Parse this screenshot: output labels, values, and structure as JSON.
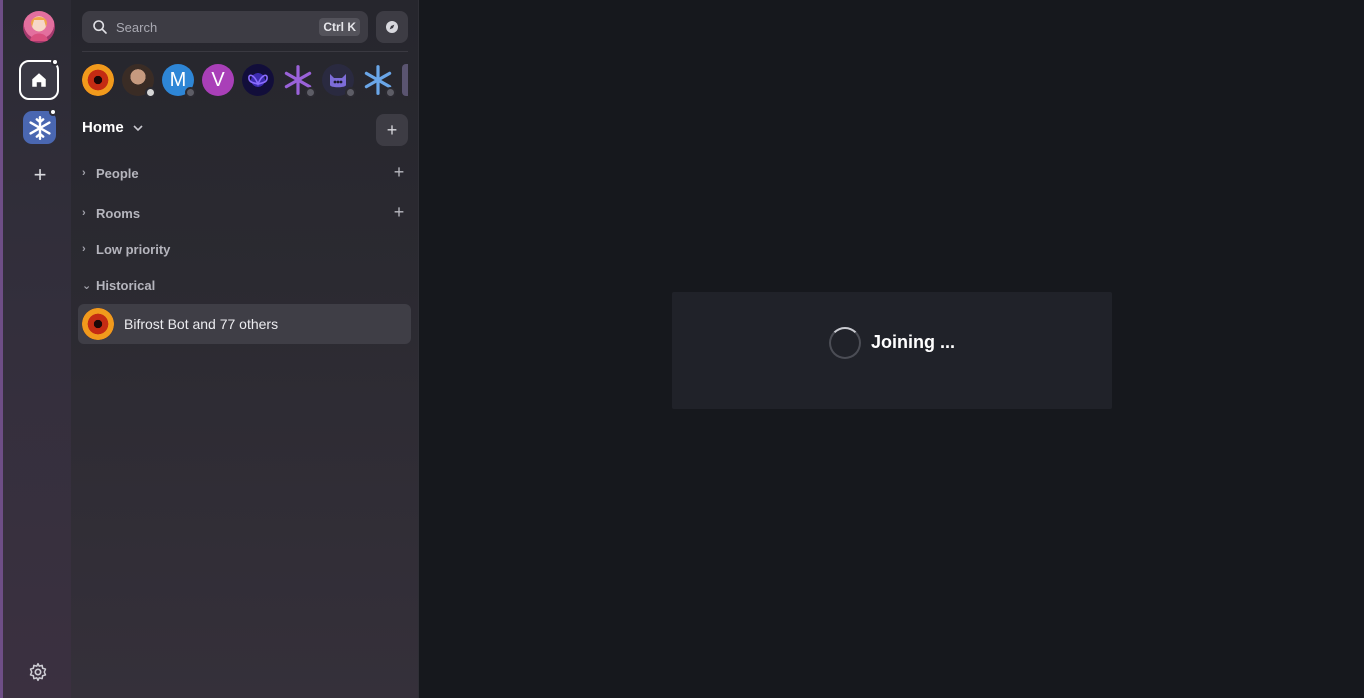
{
  "rail": {
    "items": [
      {
        "name": "home",
        "icon": "home-icon",
        "active": true,
        "unread": true
      },
      {
        "name": "space",
        "icon": "snowflake-icon",
        "unread": true
      }
    ],
    "add_icon": "plus-icon",
    "settings_icon": "gear-icon"
  },
  "sidebar": {
    "search": {
      "placeholder": "Search",
      "shortcut": "Ctrl K"
    },
    "explore_icon": "compass-icon",
    "recent_rooms": [
      {
        "kind": "image",
        "icon": "phoenix-avatar",
        "color": "#d33c16"
      },
      {
        "kind": "image",
        "icon": "person-avatar",
        "color": "#5b4a40"
      },
      {
        "kind": "letter",
        "letter": "M",
        "color": "#2e86d6"
      },
      {
        "kind": "letter",
        "letter": "V",
        "color": "#a93fb8"
      },
      {
        "kind": "image",
        "icon": "butterfly-avatar",
        "color": "#120e3a"
      },
      {
        "kind": "image",
        "icon": "snowflake-purple-avatar",
        "color": "#2b2a31"
      },
      {
        "kind": "image",
        "icon": "cat-avatar",
        "color": "#2a2a40"
      },
      {
        "kind": "image",
        "icon": "snowflake-blue-avatar",
        "color": "#2b2a31"
      }
    ],
    "home_label": "Home",
    "sections": [
      {
        "label": "People",
        "expanded": false,
        "has_add": true
      },
      {
        "label": "Rooms",
        "expanded": false,
        "has_add": true
      },
      {
        "label": "Low priority",
        "expanded": false,
        "has_add": false
      },
      {
        "label": "Historical",
        "expanded": true,
        "has_add": false
      }
    ],
    "historical_rooms": [
      {
        "name": "Bifrost Bot and 77 others",
        "selected": true
      }
    ]
  },
  "main": {
    "status": "Joining ..."
  },
  "colors": {
    "accent_border": "#6e4e86",
    "main_bg": "#16181d",
    "card_bg": "#202229"
  }
}
